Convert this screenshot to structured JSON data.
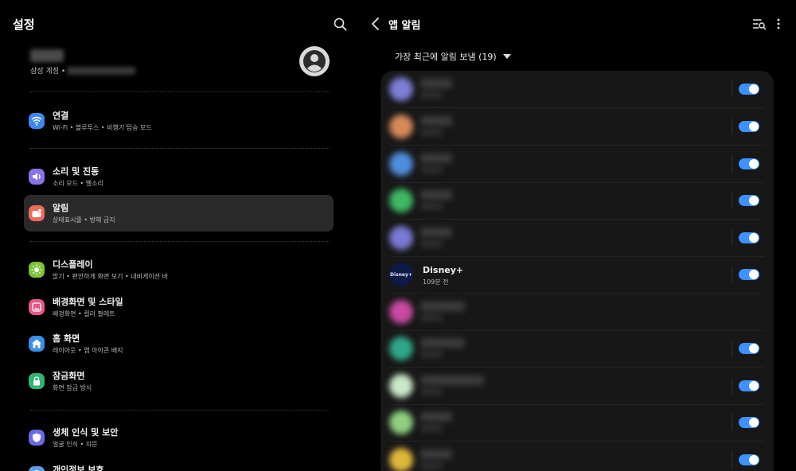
{
  "left_panel": {
    "title": "설정",
    "account": {
      "subtitle": "삼성 계정 •"
    },
    "groups": [
      [
        {
          "label": "연결",
          "subtitle": "Wi-Fi • 블루투스 • 비행기 탑승 모드",
          "icon": "wifi-icon",
          "color": "#3f86f0"
        }
      ],
      [
        {
          "label": "소리 및 진동",
          "subtitle": "소리 모드 • 벨소리",
          "icon": "volume-icon",
          "color": "#8b73e6"
        },
        {
          "label": "알림",
          "subtitle": "상태표시줄 • 방해 금지",
          "icon": "notification-icon",
          "color": "#ed6b5a",
          "selected": true
        }
      ],
      [
        {
          "label": "디스플레이",
          "subtitle": "밝기 • 편안하게 화면 보기 • 내비게이션 바",
          "icon": "brightness-icon",
          "color": "#7dc433"
        },
        {
          "label": "배경화면 및 스타일",
          "subtitle": "배경화면 • 컬러 팔레트",
          "icon": "wallpaper-icon",
          "color": "#e8578b"
        },
        {
          "label": "홈 화면",
          "subtitle": "레이아웃 • 앱 아이콘 배지",
          "icon": "home-icon",
          "color": "#3a8ee8"
        },
        {
          "label": "잠금화면",
          "subtitle": "화면 잠금 방식",
          "icon": "lock-icon",
          "color": "#2fb573"
        }
      ],
      [
        {
          "label": "생체 인식 및 보안",
          "subtitle": "얼굴 인식 • 지문",
          "icon": "shield-icon",
          "color": "#6a6ae6"
        },
        {
          "label": "개인정보 보호",
          "subtitle": "",
          "icon": "privacy-icon",
          "color": "#5aa0e6"
        }
      ]
    ]
  },
  "right_panel": {
    "title": "앱 알림",
    "sort_label": "가장 최근에 알림 보냄 (19)",
    "apps": [
      {
        "blurred": true,
        "icon_color": "#7d7fd6",
        "toggle": true
      },
      {
        "blurred": true,
        "icon_color": "#d68a5a",
        "toggle": true
      },
      {
        "blurred": true,
        "icon_color": "#4f8ede",
        "toggle": true
      },
      {
        "blurred": true,
        "icon_color": "#3fb864",
        "toggle": true
      },
      {
        "blurred": true,
        "icon_color": "#7a7ad6",
        "toggle": true
      },
      {
        "blurred": false,
        "name": "Disney+",
        "time": "109분 전",
        "icon_text": "Disney+",
        "toggle": true
      },
      {
        "blurred": true,
        "icon_color": "#c94aa0",
        "toggle": false
      },
      {
        "blurred": true,
        "icon_color": "#2fa88a",
        "toggle": true
      },
      {
        "blurred": true,
        "icon_color": "#c9e8c9",
        "toggle": true
      },
      {
        "blurred": true,
        "icon_color": "#8fcf7f",
        "toggle": true
      },
      {
        "blurred": true,
        "icon_color": "#e0b83a",
        "toggle": true
      }
    ]
  }
}
